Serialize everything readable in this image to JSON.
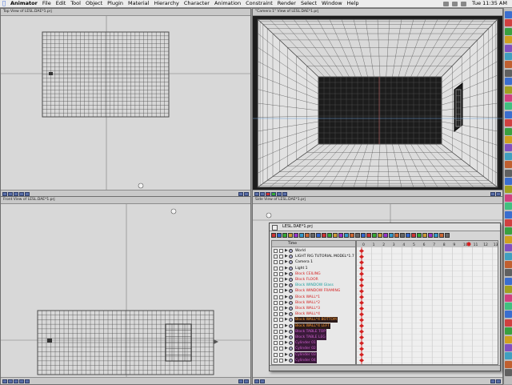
{
  "menubar": {
    "app": "Animator",
    "items": [
      "File",
      "Edit",
      "Tool",
      "Object",
      "Plugin",
      "Material",
      "Hierarchy",
      "Character",
      "Animation",
      "Constraint",
      "Render",
      "Select",
      "Window",
      "Help"
    ],
    "clock": "Tue 11:35 AM"
  },
  "viewports": {
    "top": {
      "title": "Top View of LESL.DAE*1.prj"
    },
    "camera": {
      "title": "\"Camera 1\" View of LESL.DAE*1.prj"
    },
    "front": {
      "title": "Front View of LESL.DAE*1.prj"
    },
    "side": {
      "title": "Side View of LESL.DAE*1.prj"
    }
  },
  "project_panel": {
    "title": "LESL.DAE*1.prj",
    "column_header": "Time",
    "ruler_ticks": [
      "0",
      "1",
      "2",
      "3",
      "4",
      "5",
      "6",
      "7",
      "8",
      "9",
      "10",
      "11",
      "12",
      "13"
    ],
    "tree_items": [
      {
        "label": "World",
        "bg": "#e8e8e8",
        "fg": "#000000"
      },
      {
        "label": "LIGHT RIG TUTORIAL MODEL*1.7 Fac",
        "bg": "#e8e8e8",
        "fg": "#000000"
      },
      {
        "label": "Camera 1",
        "bg": "#e8e8e8",
        "fg": "#000000"
      },
      {
        "label": "Light 1",
        "bg": "#e8e8e8",
        "fg": "#000000"
      },
      {
        "label": "Block CEILING",
        "bg": "#e8e8e8",
        "fg": "#d42020"
      },
      {
        "label": "Block FLOOR",
        "bg": "#e8e8e8",
        "fg": "#d42020"
      },
      {
        "label": "Block WINDOW Glass",
        "bg": "#e8e8e8",
        "fg": "#20a0a0"
      },
      {
        "label": "Block WINDOW FRAMING",
        "bg": "#e8e8e8",
        "fg": "#d42020"
      },
      {
        "label": "Block WALL*1",
        "bg": "#e8e8e8",
        "fg": "#d42020"
      },
      {
        "label": "Block WALL*2",
        "bg": "#e8e8e8",
        "fg": "#d42020"
      },
      {
        "label": "Block WALL*3",
        "bg": "#e8e8e8",
        "fg": "#d42020"
      },
      {
        "label": "Block WALL*4",
        "bg": "#e8e8e8",
        "fg": "#d42020"
      },
      {
        "label": "Block WALL*4 BOTTOM",
        "bg": "#2a1a1a",
        "fg": "#ff9a30"
      },
      {
        "label": "Block WALL*4 LEFT",
        "bg": "#2a1a1a",
        "fg": "#ff9a30"
      },
      {
        "label": "Block TABLE TOP",
        "bg": "#3a1a3a",
        "fg": "#d060d0"
      },
      {
        "label": "Block TABLE LEG",
        "bg": "#3a1a3a",
        "fg": "#d060d0"
      },
      {
        "label": "Cylinder 01",
        "bg": "#3a1a3a",
        "fg": "#d060d0"
      },
      {
        "label": "Cylinder 02",
        "bg": "#3a1a3a",
        "fg": "#d060d0"
      },
      {
        "label": "Cylinder 03",
        "bg": "#3a1a3a",
        "fg": "#d060d0"
      },
      {
        "label": "Cylinder 04",
        "bg": "#3a1a3a",
        "fg": "#d060d0"
      }
    ]
  }
}
